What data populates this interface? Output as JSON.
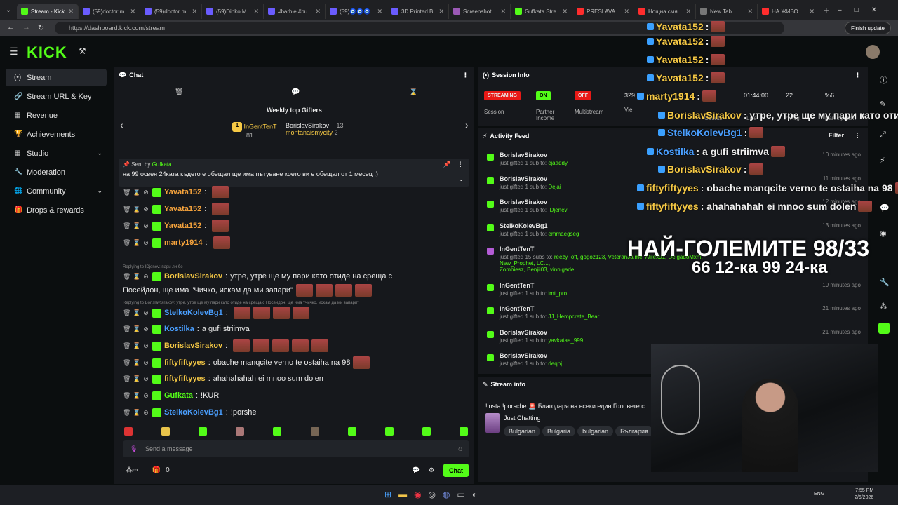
{
  "browser": {
    "tabs": [
      {
        "label": "Stream - Kick",
        "color": "#53fc18",
        "active": true
      },
      {
        "label": "(59)doctor m",
        "color": "#6a5cff"
      },
      {
        "label": "(59)doctor m",
        "color": "#6a5cff"
      },
      {
        "label": "(59)Dinko M",
        "color": "#6a5cff"
      },
      {
        "label": "#barbie #bu",
        "color": "#6a5cff"
      },
      {
        "label": "(59)🧿🧿🧿",
        "color": "#6a5cff"
      },
      {
        "label": "3D Printed B",
        "color": "#6a5cff"
      },
      {
        "label": "Screenshot",
        "color": "#9b59b6"
      },
      {
        "label": "Gufkata Stre",
        "color": "#53fc18"
      },
      {
        "label": "PRESLAVA",
        "color": "#ff2d2d"
      },
      {
        "label": "Нощна смя",
        "color": "#ff2d2d"
      },
      {
        "label": "New Tab",
        "color": "#777"
      },
      {
        "label": "НА ЖИВО",
        "color": "#ff2d2d"
      }
    ],
    "url": "https://dashboard.kick.com/stream",
    "finish_update": "Finish update"
  },
  "logo": "KICK",
  "sidebar": {
    "items": [
      {
        "label": "Stream",
        "icon": "(•)",
        "active": true
      },
      {
        "label": "Stream URL & Key",
        "icon": "🔗"
      },
      {
        "label": "Revenue",
        "icon": "▦"
      },
      {
        "label": "Achievements",
        "icon": "🏆"
      },
      {
        "label": "Studio",
        "icon": "▦",
        "chev": "⌄"
      },
      {
        "label": "Moderation",
        "icon": "🔧"
      },
      {
        "label": "Community",
        "icon": "🌐",
        "chev": "⌄"
      },
      {
        "label": "Drops & rewards",
        "icon": "🎁"
      }
    ]
  },
  "chat": {
    "title": "Chat",
    "gifters_title": "Weekly top Gifters",
    "gifter1_name": "InGentTenT",
    "gifter1_count": "81",
    "gifter2_name": "BorislavSirakov",
    "gifter2_count": "13",
    "gifter3_name": "montanaismycity",
    "gifter3_count": "2",
    "pinned_by_label": "Sent by",
    "pinned_by": "Gufkata",
    "pinned_text": "на 99 освен 24ката където е обещал ще има пътуване което ви е обещал от 1 месец ;)",
    "reply1": "Replying to IDjenev: пари ли бе",
    "reply2": "Replying to BorislavSirakov: утре, утре ще му пари като отиде на среща с Посейдон, ще има \"Чичко, искам да ми запари\"",
    "messages": [
      {
        "user": "Yavata152",
        "color": "#f6a33c",
        "text": ""
      },
      {
        "user": "Yavata152",
        "color": "#f6a33c",
        "text": ""
      },
      {
        "user": "Yavata152",
        "color": "#f6a33c",
        "text": ""
      },
      {
        "user": "marty1914",
        "color": "#f6a33c",
        "text": ""
      },
      {
        "user": "BorislavSirakov",
        "color": "#f6c945",
        "text": "утре, утре ще му пари като отиде на среща с"
      },
      {
        "user": "",
        "color": "#fff",
        "text": "Посейдон, ще има \"Чичко, искам да ми запари\""
      },
      {
        "user": "StelkoKolevBg1",
        "color": "#4a9fff",
        "text": ""
      },
      {
        "user": "Kostilka",
        "color": "#4a9fff",
        "text": "a gufi striimva"
      },
      {
        "user": "BorislavSirakov",
        "color": "#f6c945",
        "text": ""
      },
      {
        "user": "fiftyfiftyyes",
        "color": "#f6c945",
        "text": "obache manqcite verno te ostaiha na 98"
      },
      {
        "user": "fiftyfiftyyes",
        "color": "#f6c945",
        "text": "ahahahahah ei mnoo sum dolen"
      },
      {
        "user": "Gufkata",
        "color": "#53fc18",
        "text": "!KUR"
      },
      {
        "user": "StelkoKolevBg1",
        "color": "#4a9fff",
        "text": "!porshe"
      }
    ],
    "send_placeholder": "Send a message",
    "count": "0",
    "chat_button": "Chat"
  },
  "session": {
    "title": "Session Info",
    "streaming_label": "STREAMING",
    "streaming_sub": "Session",
    "partner_label": "ON",
    "partner_sub": "Partner Income",
    "multistream_label": "OFF",
    "multistream_sub": "Multistream",
    "viewers": "329",
    "viewers_sub": "Vie",
    "time": "01:44:00",
    "count2": "22",
    "percent": "%6",
    "counts_sub": "Counts",
    "live_sub": "Live",
    "avg_sub": "in Avg.",
    "participation_sub": "Participation"
  },
  "feed": {
    "title": "Activity Feed",
    "filter": "Filter",
    "items": [
      {
        "name": "BorislavSirakov",
        "pre": "just gifted 1 sub to:",
        "to": "cjaaddy",
        "time": "10 minutes ago"
      },
      {
        "name": "BorislavSirakov",
        "pre": "just gifted 1 sub to:",
        "to": "Dejai",
        "time": "11 minutes ago"
      },
      {
        "name": "BorislavSirakov",
        "pre": "just gifted 1 sub to:",
        "to": "IDjenev",
        "time": "12 minutes ago"
      },
      {
        "name": "StelkoKolevBg1",
        "pre": "just gifted 1 sub to:",
        "to": "emmaegseg",
        "time": "13 minutes ago"
      },
      {
        "name": "InGentTenT",
        "pre": "just gifted 15 subs to:",
        "to": "reezy_off, gogoz123, VeteranJaime, Atilex91, DelgadoMxm, New_Prophet, LC...,",
        "to2": "Zombiesz, Benjii03, vinnigade",
        "time": ""
      },
      {
        "name": "InGentTenT",
        "pre": "just gifted 1 sub to:",
        "to": "imt_pro",
        "time": "19 minutes ago"
      },
      {
        "name": "InGentTenT",
        "pre": "just gifted 1 sub to:",
        "to": "JJ_Hempcrete_Bear",
        "time": "21 minutes ago"
      },
      {
        "name": "BorislavSirakov",
        "pre": "just gifted 1 sub to:",
        "to": "yavkataa_999",
        "time": "21 minutes ago"
      },
      {
        "name": "BorislavSirakov",
        "pre": "just gifted 1 sub to:",
        "to": "deqnj",
        "time": ""
      }
    ]
  },
  "streaminfo": {
    "title": "Stream info",
    "stream_title": "!insta !porsche 🚨 Благодаря на всеки един Головете с",
    "category": "Just Chatting",
    "tags": [
      "Bulgarian",
      "Bulgaria",
      "bulgarian",
      "България"
    ]
  },
  "overlay": {
    "lines": [
      {
        "user": "Yavata152",
        "cls": "u-y",
        "text": ":"
      },
      {
        "user": "Yavata152",
        "cls": "u-y",
        "text": ":"
      },
      {
        "user": "Yavata152",
        "cls": "u-y",
        "text": ":"
      },
      {
        "user": "Yavata152",
        "cls": "u-y",
        "text": ":"
      },
      {
        "user": "marty1914",
        "cls": "u-y",
        "text": ":"
      },
      {
        "user": "BorislavSirakov",
        "cls": "u-y",
        "text": ": утре, утре ще му пари като отид"
      },
      {
        "user": "StelkoKolevBg1",
        "cls": "u-b",
        "text": ":"
      },
      {
        "user": "Kostilka",
        "cls": "u-b",
        "text": ": a gufi striimva"
      },
      {
        "user": "BorislavSirakov",
        "cls": "u-y",
        "text": ":"
      },
      {
        "user": "fiftyfiftyyes",
        "cls": "u-y",
        "text": ": obache manqcite verno te ostaiha na 98"
      },
      {
        "user": "fiftyfiftyyes",
        "cls": "u-y",
        "text": ": ahahahahah ei mnoo sum dolen"
      }
    ],
    "big1": "НАЙ-ГОЛЕМИТЕ 98/33",
    "big2": "66 12-ка 99 24-ка"
  },
  "taskbar": {
    "lang": "ENG",
    "time": "7:55 PM",
    "date": "2/6/2026"
  }
}
